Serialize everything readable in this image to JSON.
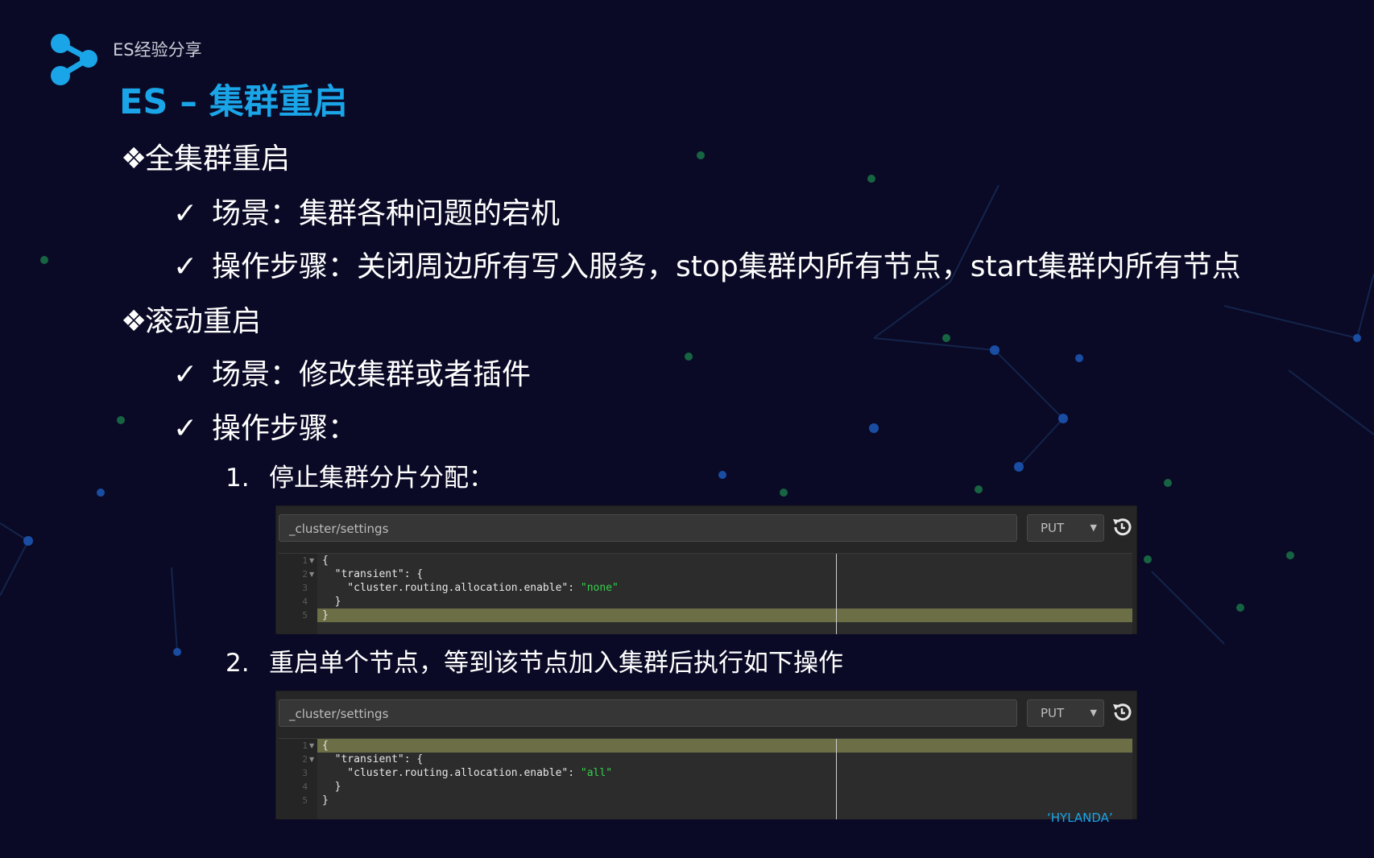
{
  "header": {
    "brand": "ES经验分享",
    "title": "ES – 集群重启"
  },
  "content": {
    "full_restart": {
      "marker": "❖",
      "heading": "全集群重启",
      "scene": "场景：集群各种问题的宕机",
      "steps": "操作步骤：关闭周边所有写入服务，stop集群内所有节点，start集群内所有节点"
    },
    "rolling_restart": {
      "marker": "❖",
      "heading": "滚动重启",
      "scene": "场景：修改集群或者插件",
      "steps_label": "操作步骤：",
      "check_mark": "✓",
      "steps": [
        {
          "number": "1.",
          "text": "停止集群分片分配："
        },
        {
          "number": "2.",
          "text": "重启单个节点，等到该节点加入集群后执行如下操作"
        }
      ]
    }
  },
  "consoles": [
    {
      "url": "_cluster/settings",
      "method": "PUT",
      "lines": [
        "1",
        "2",
        "3",
        "4",
        "5"
      ],
      "code": {
        "open": "{",
        "transient": "  \"transient\": {",
        "key": "    \"cluster.routing.allocation.enable\": ",
        "value": "\"none\"",
        "close_inner": "  }",
        "close": "}"
      }
    },
    {
      "url": "_cluster/settings",
      "method": "PUT",
      "lines": [
        "1",
        "2",
        "3",
        "4",
        "5"
      ],
      "code": {
        "open": "{",
        "transient": "  \"transient\": {",
        "key": "    \"cluster.routing.allocation.enable\": ",
        "value": "\"all\"",
        "close_inner": "  }",
        "close": "}"
      }
    }
  ],
  "footer": {
    "logo_text": "‘HYLANDA’"
  },
  "colors": {
    "background": "#0a0a26",
    "accent": "#1aa5e8",
    "string": "#32d24a",
    "highlight": "#6c6f45"
  },
  "icons": [
    "share-network-icon",
    "history-icon",
    "fold-arrow-icon"
  ]
}
